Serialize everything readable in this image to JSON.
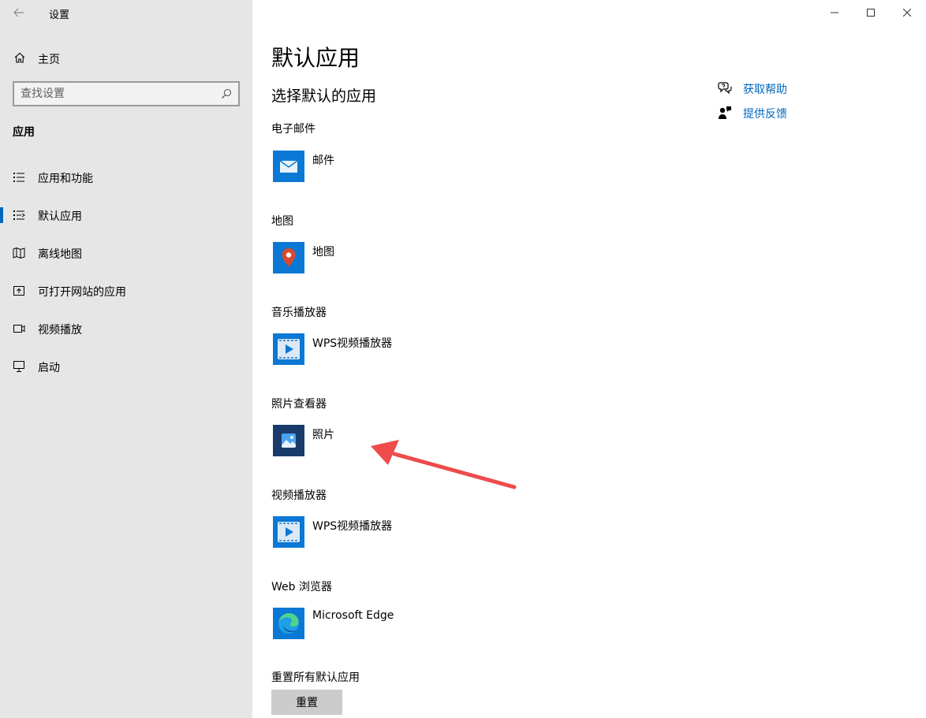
{
  "window": {
    "title": "设置",
    "controls": {
      "minimize": "minimize-icon",
      "maximize": "maximize-icon",
      "close": "close-icon"
    }
  },
  "sidebar": {
    "home_label": "主页",
    "search_placeholder": "查找设置",
    "section_title": "应用",
    "items": [
      {
        "label": "应用和功能",
        "icon": "apps-features-icon",
        "active": false
      },
      {
        "label": "默认应用",
        "icon": "default-apps-icon",
        "active": true
      },
      {
        "label": "离线地图",
        "icon": "offline-maps-icon",
        "active": false
      },
      {
        "label": "可打开网站的应用",
        "icon": "apps-for-websites-icon",
        "active": false
      },
      {
        "label": "视频播放",
        "icon": "video-playback-icon",
        "active": false
      },
      {
        "label": "启动",
        "icon": "startup-icon",
        "active": false
      }
    ]
  },
  "main": {
    "title": "默认应用",
    "subtitle": "选择默认的应用",
    "categories": [
      {
        "label": "电子邮件",
        "app": "邮件",
        "icon": "mail-app-icon"
      },
      {
        "label": "地图",
        "app": "地图",
        "icon": "maps-app-icon"
      },
      {
        "label": "音乐播放器",
        "app": "WPS视频播放器",
        "icon": "wps-player-icon"
      },
      {
        "label": "照片查看器",
        "app": "照片",
        "icon": "photos-app-icon"
      },
      {
        "label": "视频播放器",
        "app": "WPS视频播放器",
        "icon": "wps-player-icon"
      },
      {
        "label": "Web 浏览器",
        "app": "Microsoft Edge",
        "icon": "edge-icon"
      }
    ],
    "reset": {
      "label": "重置所有默认应用",
      "button": "重置"
    }
  },
  "help": {
    "get_help": "获取帮助",
    "feedback": "提供反馈"
  },
  "colors": {
    "accent": "#0067c0",
    "sidebar_bg": "#e6e6e6",
    "annotation_arrow": "#ee4b4b"
  }
}
